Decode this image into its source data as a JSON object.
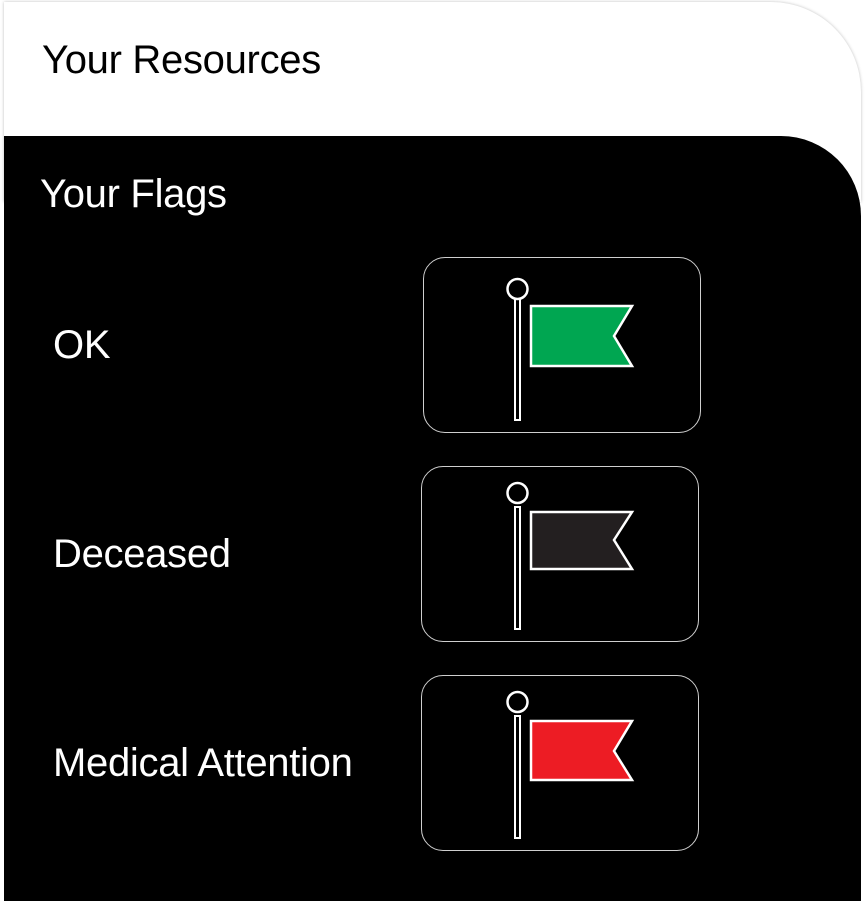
{
  "header": {
    "title": "Your Resources"
  },
  "flags_section": {
    "title": "Your Flags",
    "items": [
      {
        "label": "OK",
        "icon": "green-flag-icon",
        "color": "#00a651"
      },
      {
        "label": "Deceased",
        "icon": "black-flag-icon",
        "color": "#231f20"
      },
      {
        "label": "Medical Attention",
        "icon": "red-flag-icon",
        "color": "#ed1c24"
      }
    ]
  },
  "colors": {
    "panel_background": "#000000",
    "header_background": "#ffffff",
    "button_border": "#cfcfcf",
    "text_light": "#ffffff",
    "text_dark": "#000000"
  }
}
